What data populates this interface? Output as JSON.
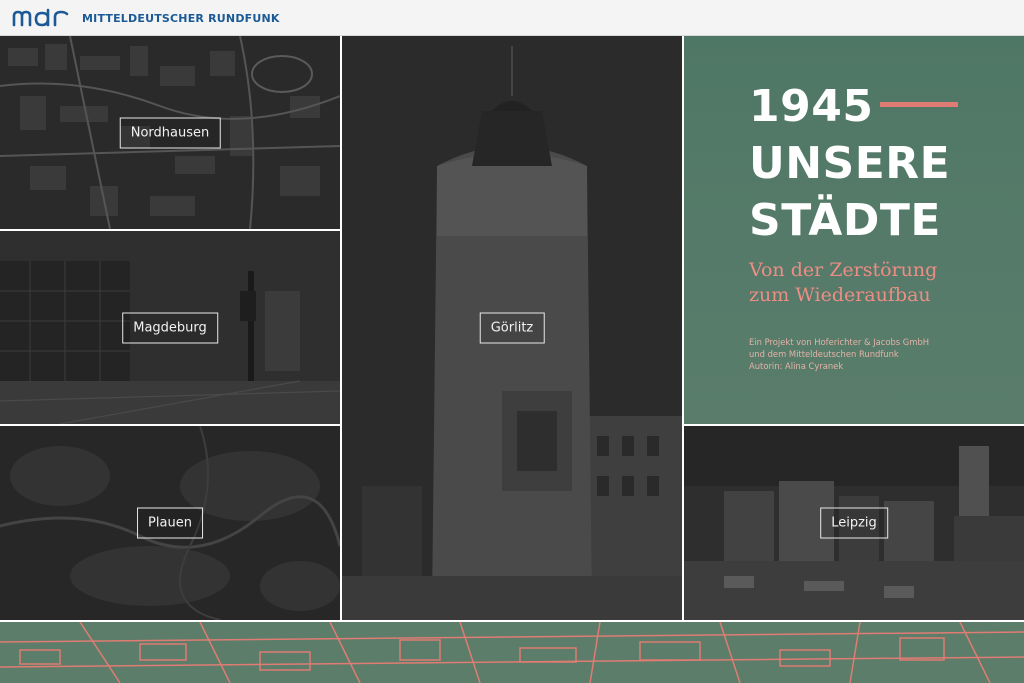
{
  "header": {
    "logo_mark": "mdr",
    "logo_text": "MITTELDEUTSCHER RUNDFUNK"
  },
  "tiles": [
    {
      "label": "Nordhausen"
    },
    {
      "label": "Magdeburg"
    },
    {
      "label": "Plauen"
    },
    {
      "label": "Görlitz"
    },
    {
      "label": "Leipzig"
    }
  ],
  "title_card": {
    "year": "1945",
    "line1": "UNSERE",
    "line2": "STÄDTE",
    "subtitle_line1": "Von der Zerstörung",
    "subtitle_line2": "zum Wiederaufbau",
    "credit1": "Ein Projekt von Hoferichter & Jacobs GmbH",
    "credit2": "und dem Mitteldeutschen Rundfunk",
    "credit3": "Autorin: Alina Cyranek"
  },
  "colors": {
    "brand_blue": "#1b5a96",
    "accent_salmon": "#e07c74",
    "title_green": "#557a69"
  }
}
